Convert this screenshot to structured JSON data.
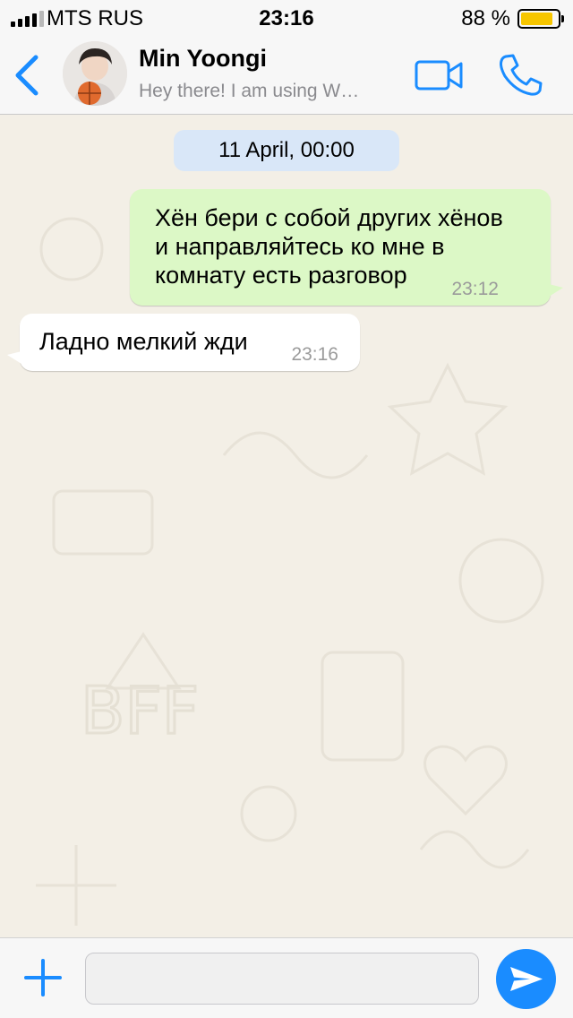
{
  "status_bar": {
    "carrier": "MTS RUS",
    "time": "23:16",
    "battery_percent": "88 %",
    "battery_level": 0.88,
    "signal_bars": 4,
    "signal_total": 5
  },
  "header": {
    "contact_name": "Min Yoongi",
    "contact_status": "Hey there! I am using W…",
    "back_icon": "chevron-left-icon",
    "video_icon": "video-camera-icon",
    "call_icon": "phone-icon",
    "accent_color": "#1a8cff"
  },
  "chat": {
    "date_label": "11 April, 00:00",
    "messages": [
      {
        "direction": "outgoing",
        "text": "Хён бери с собой других хёнов\nи направляйтесь ко мне в\nкомнату есть разговор",
        "time": "23:12"
      },
      {
        "direction": "incoming",
        "text": "Ладно мелкий жди",
        "time": "23:16"
      }
    ]
  },
  "input_bar": {
    "message_value": "",
    "add_icon": "plus-icon",
    "send_icon": "paper-plane-icon"
  },
  "colors": {
    "outgoing_bubble": "#dcf8c6",
    "incoming_bubble": "#ffffff",
    "date_pill": "#d9e7f8",
    "wallpaper": "#f3efe6",
    "battery_fill": "#f7c600"
  }
}
